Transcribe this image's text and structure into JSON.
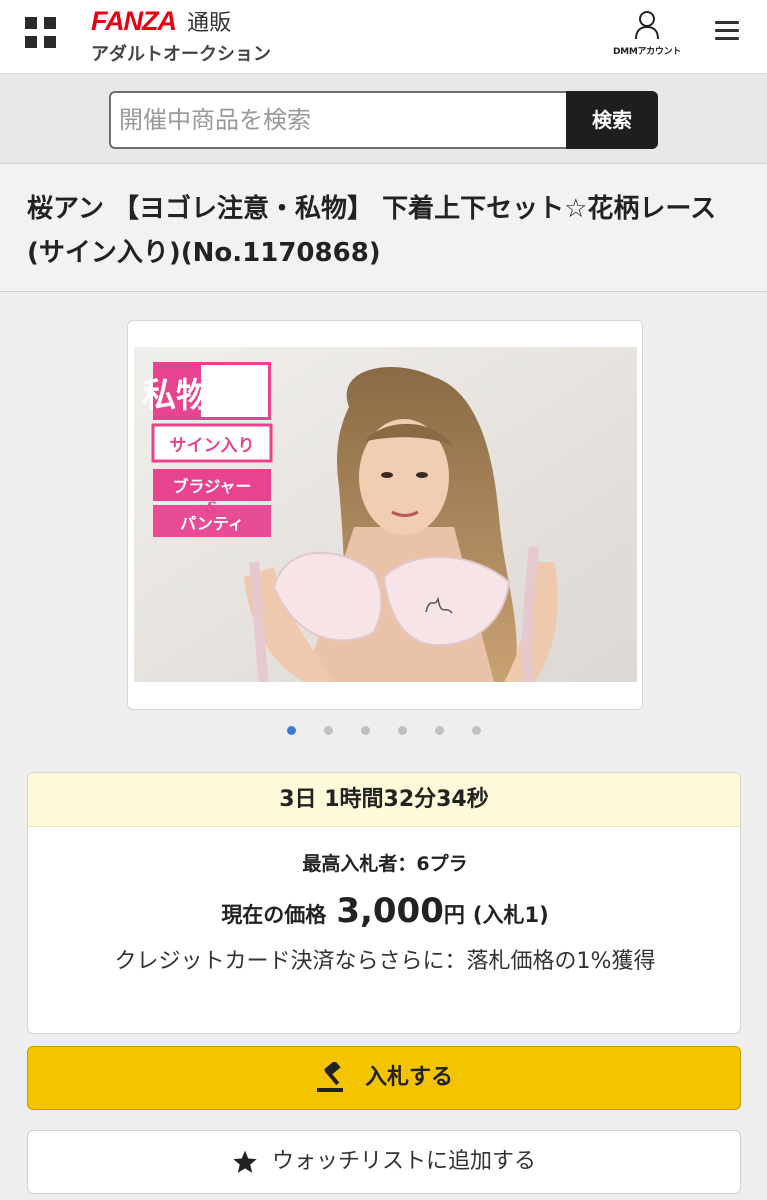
{
  "header": {
    "brand_logo": "FANZA",
    "brand_service": "通販",
    "brand_sub": "アダルトオークション",
    "account_label": "DMMアカウント",
    "icons": {
      "grid": "grid-icon",
      "account": "user-icon",
      "menu": "hamburger-menu-icon"
    },
    "brand_color": "#e60012"
  },
  "search": {
    "placeholder": "開催中商品を検索",
    "button_label": "検索"
  },
  "item": {
    "title": "桜アン 【ヨゴレ注意・私物】 下着上下セット☆花柄レース(サイン入り)(No.1170868)"
  },
  "image": {
    "badge_private": "私物",
    "badge_signed": "サイン入り",
    "badge_bra": "ブラジャー",
    "badge_amp": "&",
    "badge_panty": "パンティ",
    "badge_color": "#e8438f"
  },
  "carousel": {
    "total": 6,
    "active_index": 0,
    "active_color": "#3c7bd4"
  },
  "auction": {
    "time_left": "3日 1時間32分34秒",
    "high_bidder": "最高入札者：6プラ",
    "price_label": "現在の価格",
    "price_value": "3,000",
    "price_unit": "円",
    "bid_count": "(入札1)",
    "credit_note": "クレジットカード決済ならさらに：落札価格の1%獲得"
  },
  "actions": {
    "bid_label": "入札する",
    "bid_icon": "gavel-icon",
    "bid_color": "#f4c400",
    "watch_label": "ウォッチリストに追加する",
    "watch_icon": "star-icon"
  }
}
